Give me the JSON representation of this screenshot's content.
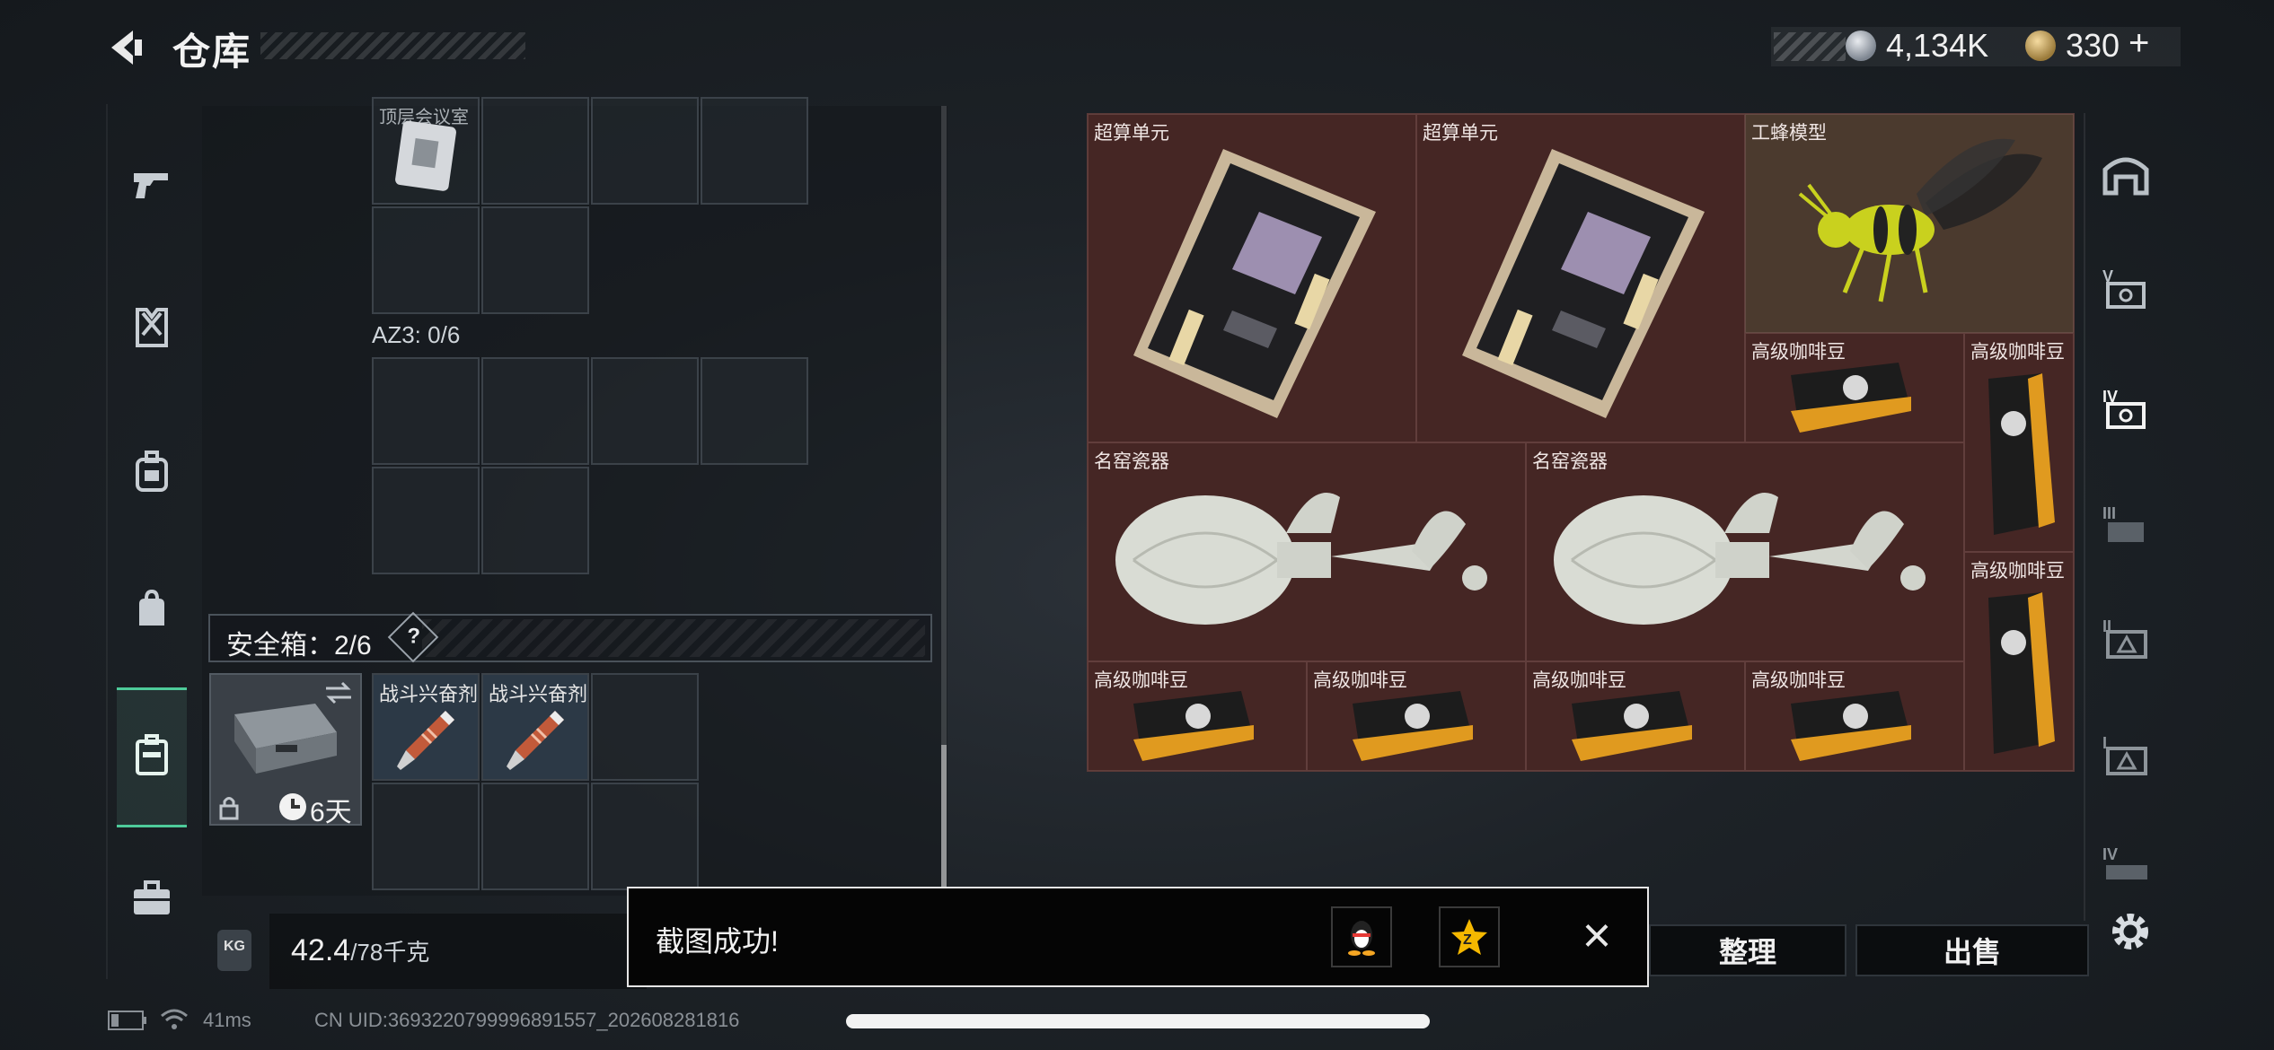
{
  "header": {
    "title": "仓库",
    "currency_silver": "4,134K",
    "currency_gold": "330",
    "gold_add": "+"
  },
  "left_nav": {
    "items": [
      "pistol-icon",
      "armor-vest-icon",
      "backpack-icon",
      "bag-icon",
      "safe-case-icon",
      "briefcase-icon"
    ],
    "active_index": 4
  },
  "container": {
    "top_partial_label": "顶层会议室",
    "az3_label": "AZ3: 0/6",
    "safe_box_label": "安全箱：2/6",
    "safe_box_help": "?",
    "safe_case_timer": "6天",
    "items": [
      {
        "label": "战斗兴奋剂"
      },
      {
        "label": "战斗兴奋剂"
      }
    ]
  },
  "weight": {
    "current": "42.4",
    "max": "/78千克",
    "kg_icon": "KG"
  },
  "stash_items": [
    {
      "label": "超算单元"
    },
    {
      "label": "超算单元"
    },
    {
      "label": "工蜂模型"
    },
    {
      "label": "高级咖啡豆"
    },
    {
      "label": "高级咖啡豆"
    },
    {
      "label": "名窑瓷器"
    },
    {
      "label": "名窑瓷器"
    },
    {
      "label": "高级咖啡豆"
    },
    {
      "label": "高级咖啡豆"
    },
    {
      "label": "高级咖啡豆"
    },
    {
      "label": "高级咖啡豆"
    },
    {
      "label": "高级咖啡豆"
    }
  ],
  "right_rail": {
    "items": [
      "base-icon",
      "tier-v-safe-icon",
      "tier-iv-safe-icon",
      "tier-iii-safe-icon",
      "tier-ii-warning-icon",
      "tier-i-warning-icon",
      "tier-iv-tray-icon"
    ]
  },
  "actions": {
    "sort_label": "整理",
    "sell_label": "出售"
  },
  "toast": {
    "message": "截图成功!",
    "close_symbol": "×"
  },
  "status_bar": {
    "ping": "41ms",
    "uid": "CN UID:3693220799996891557_202608281816"
  },
  "colors": {
    "accent": "#4ecb9a",
    "stash_bg": "#3d2322"
  }
}
